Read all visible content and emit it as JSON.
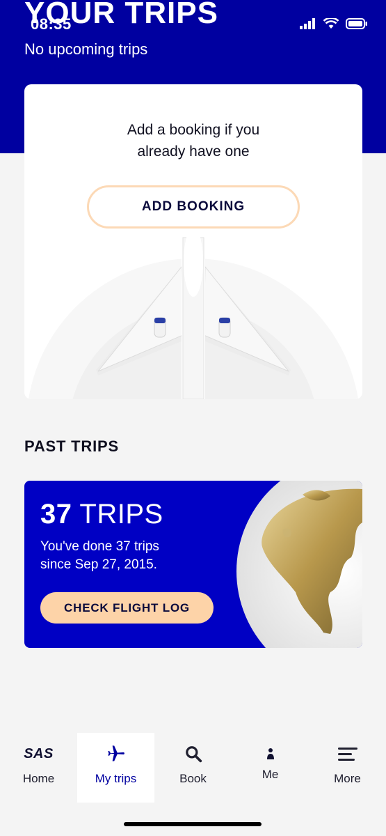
{
  "status_bar": {
    "time": "08:35"
  },
  "header": {
    "title": "YOUR TRIPS",
    "subtitle": "No upcoming trips"
  },
  "booking_card": {
    "prompt": "Add a booking if you already have one",
    "button_label": "ADD BOOKING"
  },
  "past_trips": {
    "section_title": "PAST TRIPS",
    "count": "37",
    "count_suffix": " TRIPS",
    "description": "You've done 37 trips since Sep 27, 2015.",
    "button_label": "CHECK FLIGHT LOG"
  },
  "tabbar": {
    "items": [
      {
        "label": "Home",
        "icon": "sas-logo-icon",
        "logo_text": "SAS"
      },
      {
        "label": "My trips",
        "icon": "airplane-icon",
        "active": true
      },
      {
        "label": "Book",
        "icon": "search-icon"
      },
      {
        "label": "Me",
        "icon": "person-icon"
      },
      {
        "label": "More",
        "icon": "menu-icon"
      }
    ]
  },
  "colors": {
    "header_blue": "#0000a0",
    "card_blue": "#0000c4",
    "accent_peach": "#fdd3a8"
  }
}
